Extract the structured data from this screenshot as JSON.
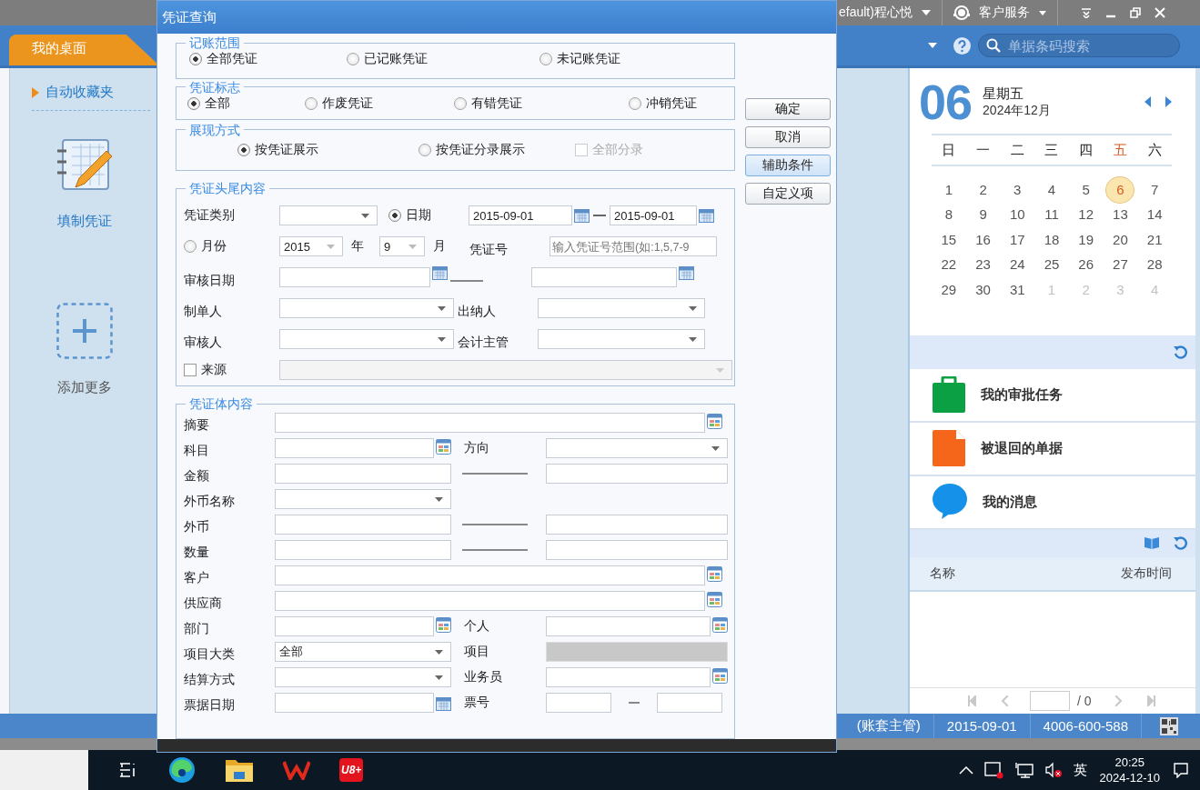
{
  "app": {
    "user_text": "efault)程心悦",
    "service": "客户服务",
    "tab": {
      "label": "我的桌面",
      "selected": true
    },
    "search": {
      "placeholder": "单据条码搜索"
    }
  },
  "sidebar": {
    "folder": "自动收藏夹",
    "shortcuts": [
      {
        "label": "填制凭证",
        "kind": "voucher"
      },
      {
        "label": "添加更多",
        "kind": "add"
      }
    ]
  },
  "calendar": {
    "day": "06",
    "weekday": "星期五",
    "month": "2024年12月",
    "weekdays": [
      {
        "label": "日",
        "today": false
      },
      {
        "label": "一",
        "today": false
      },
      {
        "label": "二",
        "today": false
      },
      {
        "label": "三",
        "today": false
      },
      {
        "label": "四",
        "today": false
      },
      {
        "label": "五",
        "today": true
      },
      {
        "label": "六",
        "today": false
      }
    ],
    "days": [
      {
        "label": "1",
        "current_month": true,
        "selected": false
      },
      {
        "label": "2",
        "current_month": true,
        "selected": false
      },
      {
        "label": "3",
        "current_month": true,
        "selected": false
      },
      {
        "label": "4",
        "current_month": true,
        "selected": false
      },
      {
        "label": "5",
        "current_month": true,
        "selected": false
      },
      {
        "label": "6",
        "current_month": true,
        "selected": true
      },
      {
        "label": "7",
        "current_month": true,
        "selected": false
      },
      {
        "label": "8",
        "current_month": true,
        "selected": false
      },
      {
        "label": "9",
        "current_month": true,
        "selected": false
      },
      {
        "label": "10",
        "current_month": true,
        "selected": false
      },
      {
        "label": "11",
        "current_month": true,
        "selected": false
      },
      {
        "label": "12",
        "current_month": true,
        "selected": false
      },
      {
        "label": "13",
        "current_month": true,
        "selected": false
      },
      {
        "label": "14",
        "current_month": true,
        "selected": false
      },
      {
        "label": "15",
        "current_month": true,
        "selected": false
      },
      {
        "label": "16",
        "current_month": true,
        "selected": false
      },
      {
        "label": "17",
        "current_month": true,
        "selected": false
      },
      {
        "label": "18",
        "current_month": true,
        "selected": false
      },
      {
        "label": "19",
        "current_month": true,
        "selected": false
      },
      {
        "label": "20",
        "current_month": true,
        "selected": false
      },
      {
        "label": "21",
        "current_month": true,
        "selected": false
      },
      {
        "label": "22",
        "current_month": true,
        "selected": false
      },
      {
        "label": "23",
        "current_month": true,
        "selected": false
      },
      {
        "label": "24",
        "current_month": true,
        "selected": false
      },
      {
        "label": "25",
        "current_month": true,
        "selected": false
      },
      {
        "label": "26",
        "current_month": true,
        "selected": false
      },
      {
        "label": "27",
        "current_month": true,
        "selected": false
      },
      {
        "label": "28",
        "current_month": true,
        "selected": false
      },
      {
        "label": "29",
        "current_month": true,
        "selected": false
      },
      {
        "label": "30",
        "current_month": true,
        "selected": false
      },
      {
        "label": "31",
        "current_month": true,
        "selected": false
      },
      {
        "label": "1",
        "current_month": false,
        "selected": false
      },
      {
        "label": "2",
        "current_month": false,
        "selected": false
      },
      {
        "label": "3",
        "current_month": false,
        "selected": false
      },
      {
        "label": "4",
        "current_month": false,
        "selected": false
      }
    ]
  },
  "tasks": [
    {
      "label": "我的审批任务",
      "kind": "briefcase"
    },
    {
      "label": "被退回的单据",
      "kind": "document"
    },
    {
      "label": "我的消息",
      "kind": "message"
    }
  ],
  "notices": {
    "columns": [
      "名称",
      "发布时间"
    ],
    "pager": "/ 0"
  },
  "status_bar": [
    "(账套主管)",
    "2015-09-01",
    "4006-600-588"
  ],
  "dialog": {
    "title": "凭证查询",
    "buttons": [
      {
        "label": "确定",
        "selected": false
      },
      {
        "label": "取消",
        "selected": false
      },
      {
        "label": "辅助条件",
        "selected": true
      },
      {
        "label": "自定义项",
        "selected": false
      }
    ],
    "range": {
      "legend": "记账范围",
      "options": [
        {
          "label": "全部凭证",
          "selected": true
        },
        {
          "label": "已记账凭证",
          "selected": false
        },
        {
          "label": "未记账凭证",
          "selected": false
        }
      ]
    },
    "flag": {
      "legend": "凭证标志",
      "options": [
        {
          "label": "全部",
          "selected": true
        },
        {
          "label": "作废凭证",
          "selected": false
        },
        {
          "label": "有错凭证",
          "selected": false
        },
        {
          "label": "冲销凭证",
          "selected": false
        }
      ]
    },
    "display": {
      "legend": "展现方式",
      "options": [
        {
          "label": "按凭证展示",
          "selected": true
        },
        {
          "label": "按凭证分录展示",
          "selected": false
        }
      ],
      "all_entries": {
        "label": "全部分录",
        "checked": false,
        "disabled": true
      }
    },
    "header": {
      "legend": "凭证头尾内容",
      "voucher_type": "凭证类别",
      "date": {
        "label": "日期",
        "selected": true,
        "from": "2015-09-01",
        "to": "2015-09-01"
      },
      "month": {
        "label": "月份",
        "selected": false,
        "year": "2015",
        "year_unit": "年",
        "month": "9",
        "month_unit": "月"
      },
      "voucher_no": {
        "label": "凭证号",
        "placeholder": "输入凭证号范围(如:1,5,7-9"
      },
      "audit_date": "审核日期",
      "people": [
        {
          "label": "制单人"
        },
        {
          "label": "出纳人"
        },
        {
          "label": "审核人"
        },
        {
          "label": "会计主管"
        }
      ],
      "source": {
        "label": "来源",
        "checked": false
      }
    },
    "body": {
      "legend": "凭证体内容",
      "rows": [
        {
          "label": "摘要",
          "kind": "ref"
        },
        {
          "label": "科目",
          "kind": "ref",
          "right": {
            "label": "方向",
            "kind": "select"
          }
        },
        {
          "label": "金额",
          "kind": "text",
          "right": {
            "kind": "range"
          }
        },
        {
          "label": "外币名称",
          "kind": "select"
        },
        {
          "label": "外币",
          "kind": "text",
          "right": {
            "kind": "range"
          }
        },
        {
          "label": "数量",
          "kind": "text",
          "right": {
            "kind": "range"
          }
        },
        {
          "label": "客户",
          "kind": "ref"
        },
        {
          "label": "供应商",
          "kind": "ref"
        },
        {
          "label": "部门",
          "kind": "ref",
          "right": {
            "label": "个人",
            "kind": "ref"
          }
        },
        {
          "label": "项目大类",
          "kind": "select",
          "value": "全部",
          "right": {
            "label": "项目",
            "kind": "disabled"
          }
        },
        {
          "label": "结算方式",
          "kind": "select",
          "right": {
            "label": "业务员",
            "kind": "ref"
          }
        },
        {
          "label": "票据日期",
          "kind": "date",
          "right": {
            "label": "票号",
            "kind": "pair"
          }
        }
      ]
    }
  },
  "taskbar": {
    "app_label": "U8+",
    "ime": "英",
    "time": "20:25",
    "date": "2024-12-10"
  }
}
